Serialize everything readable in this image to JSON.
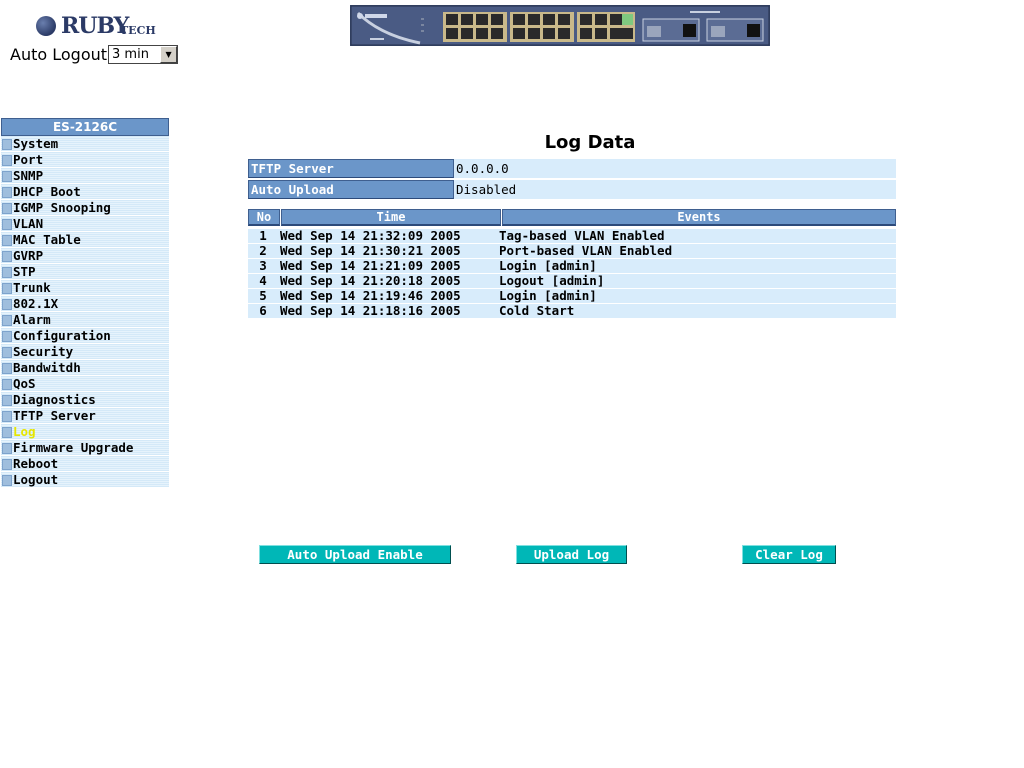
{
  "header": {
    "brand": "RUBY",
    "brand_suffix": "TECH",
    "auto_logout_label": "Auto Logout",
    "auto_logout_value": "3 min"
  },
  "sidebar": {
    "title": "ES-2126C",
    "items": [
      {
        "label": "System"
      },
      {
        "label": "Port"
      },
      {
        "label": "SNMP"
      },
      {
        "label": "DHCP Boot"
      },
      {
        "label": "IGMP Snooping"
      },
      {
        "label": "VLAN"
      },
      {
        "label": "MAC Table"
      },
      {
        "label": "GVRP"
      },
      {
        "label": "STP"
      },
      {
        "label": "Trunk"
      },
      {
        "label": "802.1X"
      },
      {
        "label": "Alarm"
      },
      {
        "label": "Configuration"
      },
      {
        "label": "Security"
      },
      {
        "label": "Bandwitdh"
      },
      {
        "label": "QoS"
      },
      {
        "label": "Diagnostics"
      },
      {
        "label": "TFTP Server"
      },
      {
        "label": "Log",
        "active": true
      },
      {
        "label": "Firmware Upgrade"
      },
      {
        "label": "Reboot"
      },
      {
        "label": "Logout"
      }
    ]
  },
  "main": {
    "title": "Log Data",
    "info": [
      {
        "label": "TFTP Server",
        "value": "0.0.0.0"
      },
      {
        "label": "Auto Upload",
        "value": "Disabled"
      }
    ],
    "log_columns": [
      "No",
      "Time",
      "Events"
    ],
    "log_rows": [
      {
        "no": "1",
        "time": "Wed Sep 14 21:32:09 2005",
        "event": "Tag-based VLAN Enabled"
      },
      {
        "no": "2",
        "time": "Wed Sep 14 21:30:21 2005",
        "event": "Port-based VLAN Enabled"
      },
      {
        "no": "3",
        "time": "Wed Sep 14 21:21:09 2005",
        "event": "Login [admin]"
      },
      {
        "no": "4",
        "time": "Wed Sep 14 21:20:18 2005",
        "event": "Logout [admin]"
      },
      {
        "no": "5",
        "time": "Wed Sep 14 21:19:46 2005",
        "event": "Login [admin]"
      },
      {
        "no": "6",
        "time": "Wed Sep 14 21:18:16 2005",
        "event": "Cold Start"
      }
    ],
    "buttons": {
      "auto_upload": "Auto Upload Enable",
      "upload_log": "Upload Log",
      "clear_log": "Clear Log"
    }
  },
  "colors": {
    "menu_header": "#6b96c9",
    "row_bg": "#d8ecfb",
    "button": "#00b7b7",
    "active_item": "#e6e600"
  }
}
